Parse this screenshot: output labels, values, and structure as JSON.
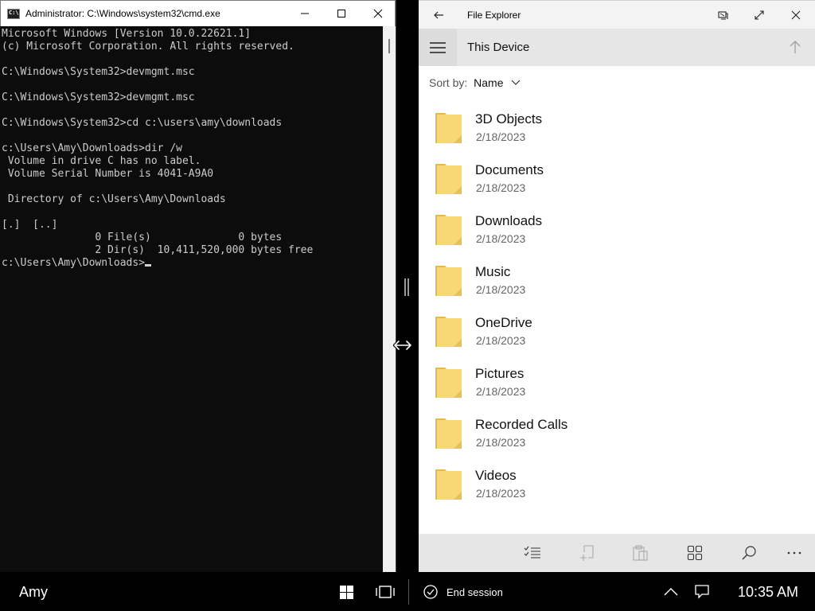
{
  "cmd": {
    "title": "Administrator: C:\\Windows\\system32\\cmd.exe",
    "app_icon_text": "C:\\",
    "output": "Microsoft Windows [Version 10.0.22621.1]\n(c) Microsoft Corporation. All rights reserved.\n\nC:\\Windows\\System32>devmgmt.msc\n\nC:\\Windows\\System32>devmgmt.msc\n\nC:\\Windows\\System32>cd c:\\users\\amy\\downloads\n\nc:\\Users\\Amy\\Downloads>dir /w\n Volume in drive C has no label.\n Volume Serial Number is 4041-A9A0\n\n Directory of c:\\Users\\Amy\\Downloads\n\n[.]  [..]\n               0 File(s)              0 bytes\n               2 Dir(s)  10,411,520,000 bytes free\n",
    "prompt": "c:\\Users\\Amy\\Downloads>"
  },
  "explorer": {
    "title": "File Explorer",
    "location": "This Device",
    "sort_label": "Sort by:",
    "sort_value": "Name",
    "items": [
      {
        "name": "3D Objects",
        "date": "2/18/2023"
      },
      {
        "name": "Documents",
        "date": "2/18/2023"
      },
      {
        "name": "Downloads",
        "date": "2/18/2023"
      },
      {
        "name": "Music",
        "date": "2/18/2023"
      },
      {
        "name": "OneDrive",
        "date": "2/18/2023"
      },
      {
        "name": "Pictures",
        "date": "2/18/2023"
      },
      {
        "name": "Recorded Calls",
        "date": "2/18/2023"
      },
      {
        "name": "Videos",
        "date": "2/18/2023"
      }
    ],
    "appbar_icons": [
      "select-list-icon",
      "new-folder-icon",
      "paste-icon",
      "view-grid-icon",
      "search-icon",
      "more-icon"
    ],
    "folder_color": "#f8d775"
  },
  "taskbar": {
    "user": "Amy",
    "end_session": "End session",
    "clock": "10:35 AM"
  }
}
